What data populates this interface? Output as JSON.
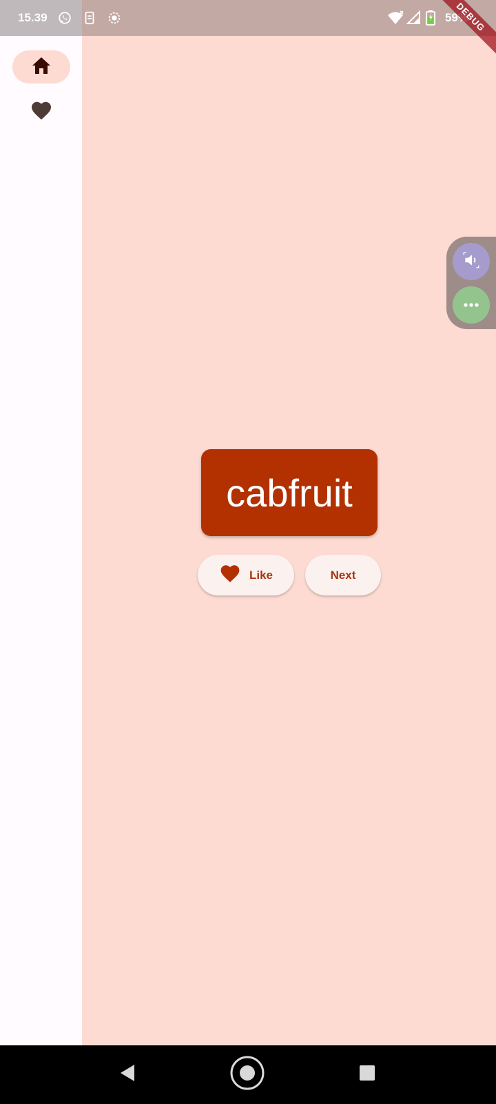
{
  "status_bar": {
    "time": "15.39",
    "battery_percent": "59%",
    "left_icons": [
      "whatsapp-icon",
      "sim-toolkit-icon",
      "screen-record-icon"
    ],
    "right_icons": [
      "wifi-icon",
      "signal-icon",
      "battery-icon"
    ]
  },
  "debug_banner": {
    "label": "DEBUG"
  },
  "nav_rail": {
    "items": [
      {
        "icon": "home-icon",
        "selected": true
      },
      {
        "icon": "heart-icon",
        "selected": false
      }
    ]
  },
  "main": {
    "word": "cabfruit",
    "like_label": "Like",
    "next_label": "Next"
  },
  "floating_panel": {
    "buttons": [
      "volume-icon",
      "more-icon"
    ]
  },
  "colors": {
    "background": "#fddbd2",
    "rail": "#fffbff",
    "card": "#b33000",
    "button_bg": "#fbf1ef",
    "accent_text": "#a8370e"
  }
}
